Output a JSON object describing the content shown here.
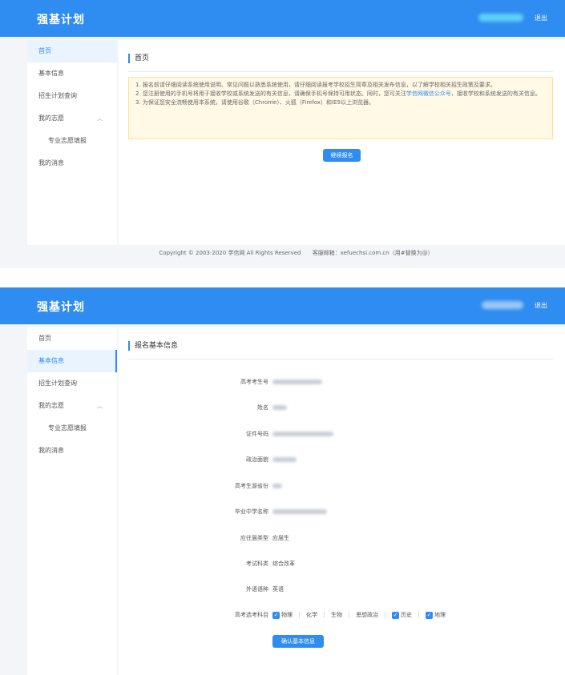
{
  "app": {
    "brand": "强基计划",
    "logout": "退出"
  },
  "sidebar": {
    "items": [
      {
        "label": "首页"
      },
      {
        "label": "基本信息"
      },
      {
        "label": "招生计划查询"
      },
      {
        "label": "我的志愿",
        "chevron": "︿"
      },
      {
        "label": "专业志愿填报"
      },
      {
        "label": "我的消息"
      }
    ]
  },
  "home": {
    "title": "首页",
    "notice": {
      "line1": "1. 报名前请仔细阅读系统使用说明、常见问题以熟悉系统使用，请仔细阅读报考学校招生简章及相关发布信息，以了解学校相关招生政策及要求。",
      "line2_before": "2. 您注册使用的手机号将用于接收学校或系统发送的有关信息，请确保手机号保持可用状态。同时，您可关注",
      "line2_link": "学信网微信公众号",
      "line2_after": "，接收学校和系统发送的有关信息。",
      "line3": "3. 为保证您安全流畅使用本系统，请使用谷歌（Chrome）、火狐（Firefox）和IE9以上浏览器。"
    },
    "apply_button": "继续报名"
  },
  "footer": {
    "copyright": "Copyright © 2003-2020 学信网 All Rights Reserved",
    "email": "客服邮箱：xefuechsi.com.cn（用#替换为@）"
  },
  "basic_info": {
    "title": "报名基本信息",
    "fields": [
      {
        "label": "高考考生号"
      },
      {
        "label": "姓名"
      },
      {
        "label": "证件号码"
      },
      {
        "label": "政治面貌"
      },
      {
        "label": "高考生源省份"
      },
      {
        "label": "毕业中学名称"
      },
      {
        "label": "应往届类型",
        "value": "应届生"
      },
      {
        "label": "考试科类",
        "value": "综合改革"
      },
      {
        "label": "外语语种",
        "value": "英语"
      },
      {
        "label": "高考选考科目"
      }
    ],
    "subjects": [
      {
        "name": "物理",
        "checked": true
      },
      {
        "name": "化学",
        "checked": false
      },
      {
        "name": "生物",
        "checked": false
      },
      {
        "name": "思想政治",
        "checked": false
      },
      {
        "name": "历史",
        "checked": true
      },
      {
        "name": "地理",
        "checked": true
      }
    ],
    "confirm_button": "确认基本信息"
  }
}
